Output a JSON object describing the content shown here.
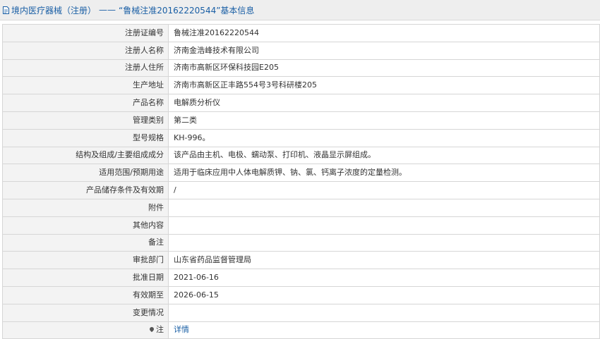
{
  "header": {
    "title": "境内医疗器械（注册）",
    "separator": "——",
    "subtitle": "“鲁械注准20162220544”基本信息",
    "icon": "document-icon"
  },
  "rows": [
    {
      "key": "registration-number",
      "label": "注册证编号",
      "value": "鲁械注准20162220544"
    },
    {
      "key": "registrant-name",
      "label": "注册人名称",
      "value": "济南金浩峰技术有限公司"
    },
    {
      "key": "registrant-address",
      "label": "注册人住所",
      "value": "济南市高新区环保科技园E205"
    },
    {
      "key": "production-address",
      "label": "生产地址",
      "value": "济南市高新区正丰路554号3号科研楼205"
    },
    {
      "key": "product-name",
      "label": "产品名称",
      "value": "电解质分析仪"
    },
    {
      "key": "management-category",
      "label": "管理类别",
      "value": "第二类"
    },
    {
      "key": "model-spec",
      "label": "型号规格",
      "value": "KH-996。"
    },
    {
      "key": "structure",
      "label": "结构及组成/主要组成成分",
      "value": "该产品由主机、电极、蠕动泵、打印机、液晶显示屏组成。"
    },
    {
      "key": "intended-use",
      "label": "适用范围/预期用途",
      "value": "适用于临床应用中人体电解质钾、钠、氯、钙离子浓度的定量检测。"
    },
    {
      "key": "storage",
      "label": "产品储存条件及有效期",
      "value": "/"
    },
    {
      "key": "attachment",
      "label": "附件",
      "value": ""
    },
    {
      "key": "other",
      "label": "其他内容",
      "value": ""
    },
    {
      "key": "remarks",
      "label": "备注",
      "value": ""
    },
    {
      "key": "approval-dept",
      "label": "审批部门",
      "value": "山东省药品监督管理局"
    },
    {
      "key": "approval-date",
      "label": "批准日期",
      "value": "2021-06-16"
    },
    {
      "key": "expiry-date",
      "label": "有效期至",
      "value": "2026-06-15"
    },
    {
      "key": "change-status",
      "label": "变更情况",
      "value": ""
    },
    {
      "key": "note",
      "label": "注",
      "value": "详情",
      "icon": "pin-icon",
      "link": true
    }
  ]
}
